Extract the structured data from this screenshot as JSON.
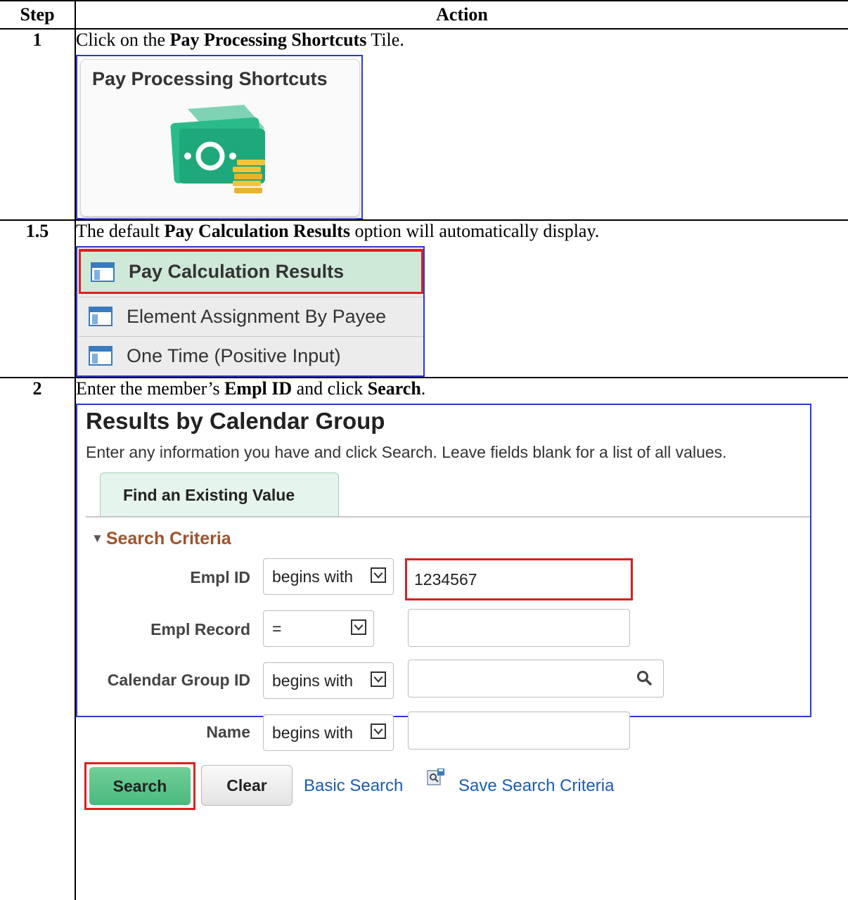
{
  "table": {
    "col_step": "Step",
    "col_action": "Action"
  },
  "rows": [
    {
      "step": "1",
      "text": {
        "pre": "Click on the ",
        "bold": "Pay Processing Shortcuts",
        "post": " Tile."
      },
      "tile": {
        "title": "Pay Processing Shortcuts",
        "icon": "money-cash-icon"
      }
    },
    {
      "step": "1.5",
      "text": {
        "pre": "The default ",
        "bold": "Pay Calculation Results",
        "post": " option will automatically display."
      },
      "menu": [
        {
          "label": "Pay Calculation Results",
          "icon": "page-icon",
          "active": true
        },
        {
          "label": "Element Assignment By Payee",
          "icon": "page-icon"
        },
        {
          "label": "One Time (Positive Input)",
          "icon": "page-icon"
        }
      ]
    },
    {
      "step": "2",
      "text": {
        "pre": "Enter the member’s ",
        "bold1": "Empl ID",
        "mid": " and click ",
        "bold2": "Search",
        "post": "."
      },
      "search_page": {
        "title": "Results by Calendar Group",
        "subtitle": "Enter any information you have and click Search. Leave fields blank for a list of all values.",
        "tab": "Find an Existing Value",
        "section": "Search Criteria",
        "fields": [
          {
            "label": "Empl ID",
            "operator": "begins with",
            "value": "1234567"
          },
          {
            "label": "Empl Record",
            "operator": "=",
            "value": ""
          },
          {
            "label": "Calendar Group ID",
            "operator": "begins with",
            "value": ""
          },
          {
            "label": "Name",
            "operator": "begins with",
            "value": ""
          }
        ],
        "buttons": {
          "search": "Search",
          "clear": "Clear"
        },
        "links": {
          "basic_search": "Basic Search",
          "save_criteria": "Save Search Criteria"
        },
        "colors": {
          "highlight": "#e01e1e",
          "frame": "#2b38d8",
          "link": "#1a5bb5"
        }
      }
    }
  ]
}
